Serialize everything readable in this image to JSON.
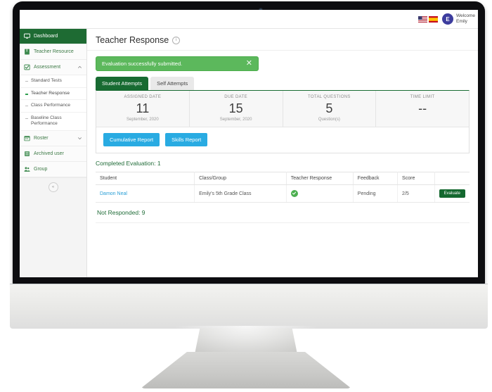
{
  "topbar": {
    "flags": [
      "us-flag-icon",
      "spain-flag-icon"
    ],
    "avatar_initial": "E",
    "welcome_line1": "Welcome",
    "welcome_line2": "Emily"
  },
  "sidebar": {
    "items": [
      {
        "label": "Dashboard",
        "icon": "monitor-icon",
        "active": true
      },
      {
        "label": "Teacher Resource",
        "icon": "book-icon",
        "active": false
      },
      {
        "label": "Assessment",
        "icon": "checklist-icon",
        "active": false,
        "chevron": "chevron-up-icon"
      }
    ],
    "sub_items": [
      {
        "label": "Standard Tests",
        "current": false
      },
      {
        "label": "Teacher Response",
        "current": true
      },
      {
        "label": "Class Performance",
        "current": false
      },
      {
        "label": "Baseline Class Performance",
        "current": false
      }
    ],
    "items_lower": [
      {
        "label": "Roster",
        "icon": "calendar-icon",
        "chevron": "chevron-down-icon"
      },
      {
        "label": "Archived user",
        "icon": "list-icon"
      },
      {
        "label": "Group",
        "icon": "people-icon"
      }
    ],
    "collapse_label": "«"
  },
  "page": {
    "title": "Teacher Response",
    "info_icon": "info-icon",
    "alert": {
      "message": "Evaluation successfully submitted.",
      "close_label": "✕",
      "color": "#5cb85c"
    },
    "tabs": [
      {
        "label": "Student Attempts",
        "active": true
      },
      {
        "label": "Self Attempts",
        "active": false
      }
    ],
    "stats": [
      {
        "label": "ASSIGNED DATE",
        "value": "11",
        "sub": "September, 2020"
      },
      {
        "label": "DUE DATE",
        "value": "15",
        "sub": "September, 2020"
      },
      {
        "label": "TOTAL QUESTIONS",
        "value": "5",
        "sub": "Question(s)"
      },
      {
        "label": "TIME LIMIT",
        "value": "--",
        "sub": ""
      }
    ],
    "report_buttons": [
      {
        "label": "Cumulative Report",
        "color": "#29abe2"
      },
      {
        "label": "Skills Report",
        "color": "#29abe2"
      }
    ],
    "completed_heading": "Completed Evaluation: 1",
    "table": {
      "columns": [
        "Student",
        "Class/Group",
        "Teacher Response",
        "Feedback",
        "Score",
        ""
      ],
      "rows": [
        {
          "student": "Damon Neal",
          "class_group": "Emily's 5th Grade Class",
          "teacher_response": "check-circle-icon",
          "feedback": "Pending",
          "score": "2/5",
          "action_label": "Evaluate"
        }
      ]
    },
    "not_responded": "Not Responded: 9"
  },
  "colors": {
    "brand_green": "#186b32",
    "accent_blue": "#29abe2",
    "success_green": "#5cb85c",
    "link_blue": "#2a9fd6"
  }
}
